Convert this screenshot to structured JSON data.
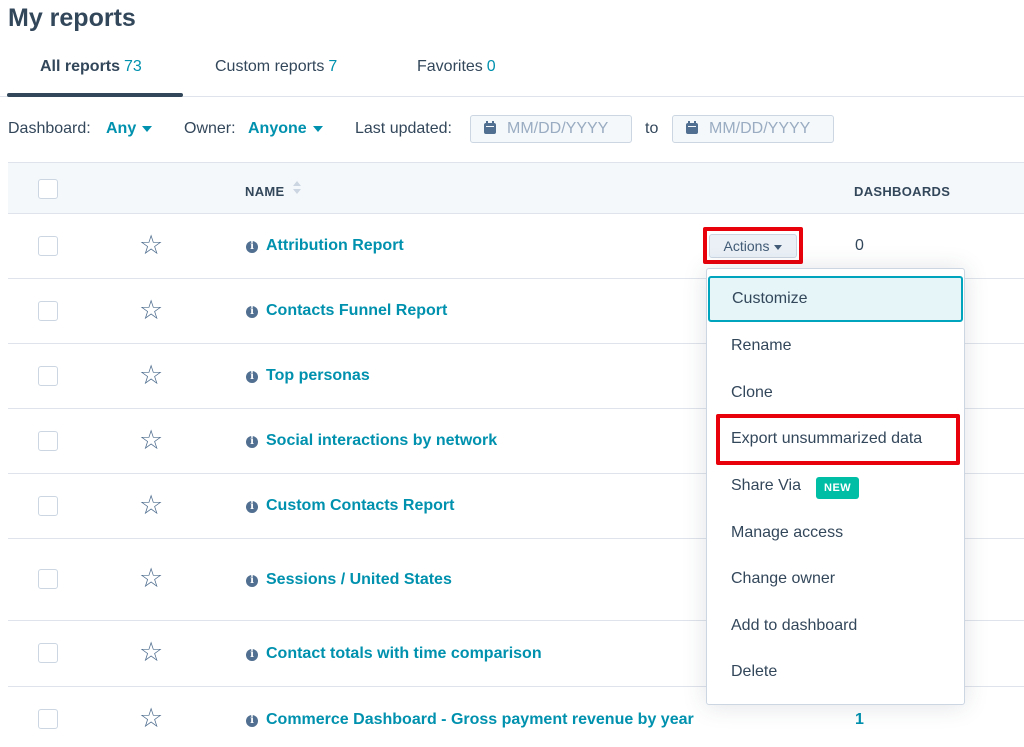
{
  "page": {
    "title": "My reports"
  },
  "tabs": [
    {
      "label": "All reports",
      "count": "73"
    },
    {
      "label": "Custom reports",
      "count": "7"
    },
    {
      "label": "Favorites",
      "count": "0"
    }
  ],
  "filters": {
    "dashboard_label": "Dashboard:",
    "dashboard_value": "Any",
    "owner_label": "Owner:",
    "owner_value": "Anyone",
    "updated_label": "Last updated:",
    "date_placeholder": "MM/DD/YYYY",
    "to_label": "to"
  },
  "table": {
    "col_name": "NAME",
    "col_dashboards": "DASHBOARDS",
    "rows": [
      {
        "name": "Attribution Report",
        "dashboards": "0"
      },
      {
        "name": "Contacts Funnel Report",
        "dashboards": ""
      },
      {
        "name": "Top personas",
        "dashboards": ""
      },
      {
        "name": "Social interactions by network",
        "dashboards": ""
      },
      {
        "name": "Custom Contacts Report",
        "dashboards": ""
      },
      {
        "name": "Sessions / United States",
        "dashboards": ""
      },
      {
        "name": "Contact totals with time comparison",
        "dashboards": ""
      },
      {
        "name": "Commerce Dashboard - Gross payment revenue by year",
        "dashboards": "1"
      }
    ]
  },
  "actions": {
    "button_label": "Actions",
    "menu": [
      "Customize",
      "Rename",
      "Clone",
      "Export unsummarized data",
      "Share Via",
      "Manage access",
      "Change owner",
      "Add to dashboard",
      "Delete"
    ],
    "new_badge": "NEW"
  },
  "icons": {
    "favorite": "star-outline-icon",
    "info": "info-circle-icon",
    "calendar": "calendar-icon",
    "sort": "sort-icon",
    "dropdown": "caret-down-icon"
  },
  "colors": {
    "link": "#0091ae",
    "text": "#33475b",
    "highlight_annotation": "#e8000a",
    "badge": "#00bda5",
    "focus_border": "#00a4bd"
  }
}
